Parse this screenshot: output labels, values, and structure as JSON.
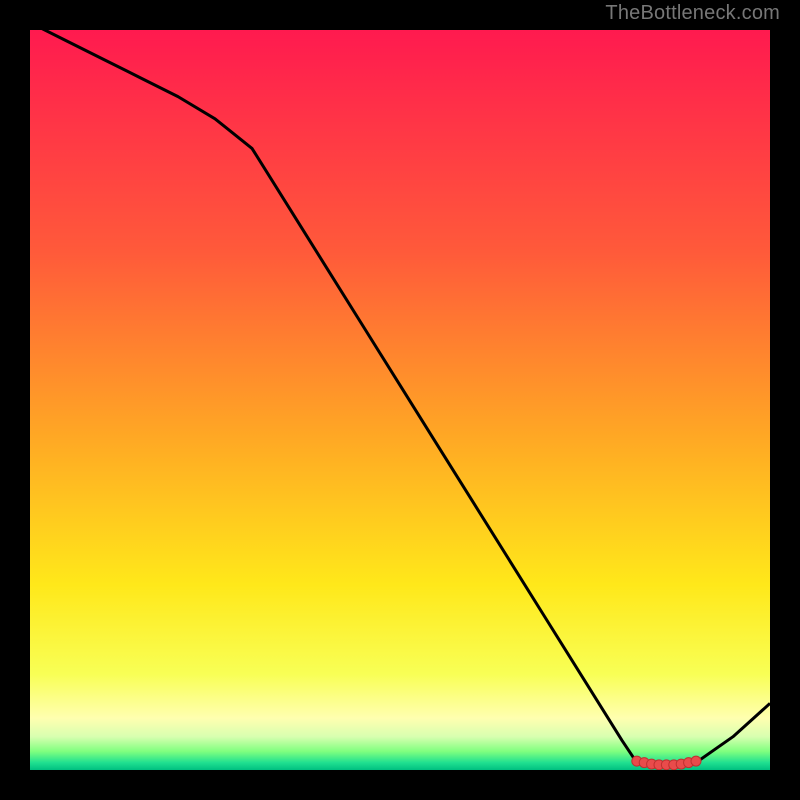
{
  "watermark": "TheBottleneck.com",
  "chart_data": {
    "type": "line",
    "title": "",
    "xlabel": "",
    "ylabel": "",
    "x": [
      0,
      5,
      10,
      15,
      20,
      25,
      30,
      35,
      40,
      45,
      50,
      55,
      60,
      65,
      70,
      75,
      80,
      82,
      85,
      88,
      90,
      95,
      100
    ],
    "values": [
      101,
      98.5,
      96,
      93.5,
      91,
      88,
      84,
      76,
      68,
      60,
      52,
      44,
      36,
      28,
      20,
      12,
      4,
      1,
      0.5,
      0.5,
      1,
      4.5,
      9
    ],
    "scatter_x": [
      82,
      83,
      84,
      85,
      86,
      87,
      88,
      89,
      90
    ],
    "scatter_y": [
      1.2,
      1.0,
      0.8,
      0.7,
      0.7,
      0.7,
      0.8,
      1.0,
      1.2
    ],
    "xlim": [
      0,
      100
    ],
    "ylim": [
      0,
      100
    ],
    "gradient_stops": [
      {
        "offset": 0,
        "color": "#ff1a4f"
      },
      {
        "offset": 30,
        "color": "#ff5a3a"
      },
      {
        "offset": 55,
        "color": "#ffa824"
      },
      {
        "offset": 75,
        "color": "#ffe81a"
      },
      {
        "offset": 87,
        "color": "#f8ff55"
      },
      {
        "offset": 93,
        "color": "#ffffb0"
      },
      {
        "offset": 95.5,
        "color": "#d8ffb0"
      },
      {
        "offset": 97.5,
        "color": "#7fff7f"
      },
      {
        "offset": 99,
        "color": "#20e090"
      },
      {
        "offset": 100,
        "color": "#00c080"
      }
    ],
    "line_color": "#000000",
    "scatter_fill": "#e94b4b",
    "scatter_stroke": "#c03030"
  }
}
